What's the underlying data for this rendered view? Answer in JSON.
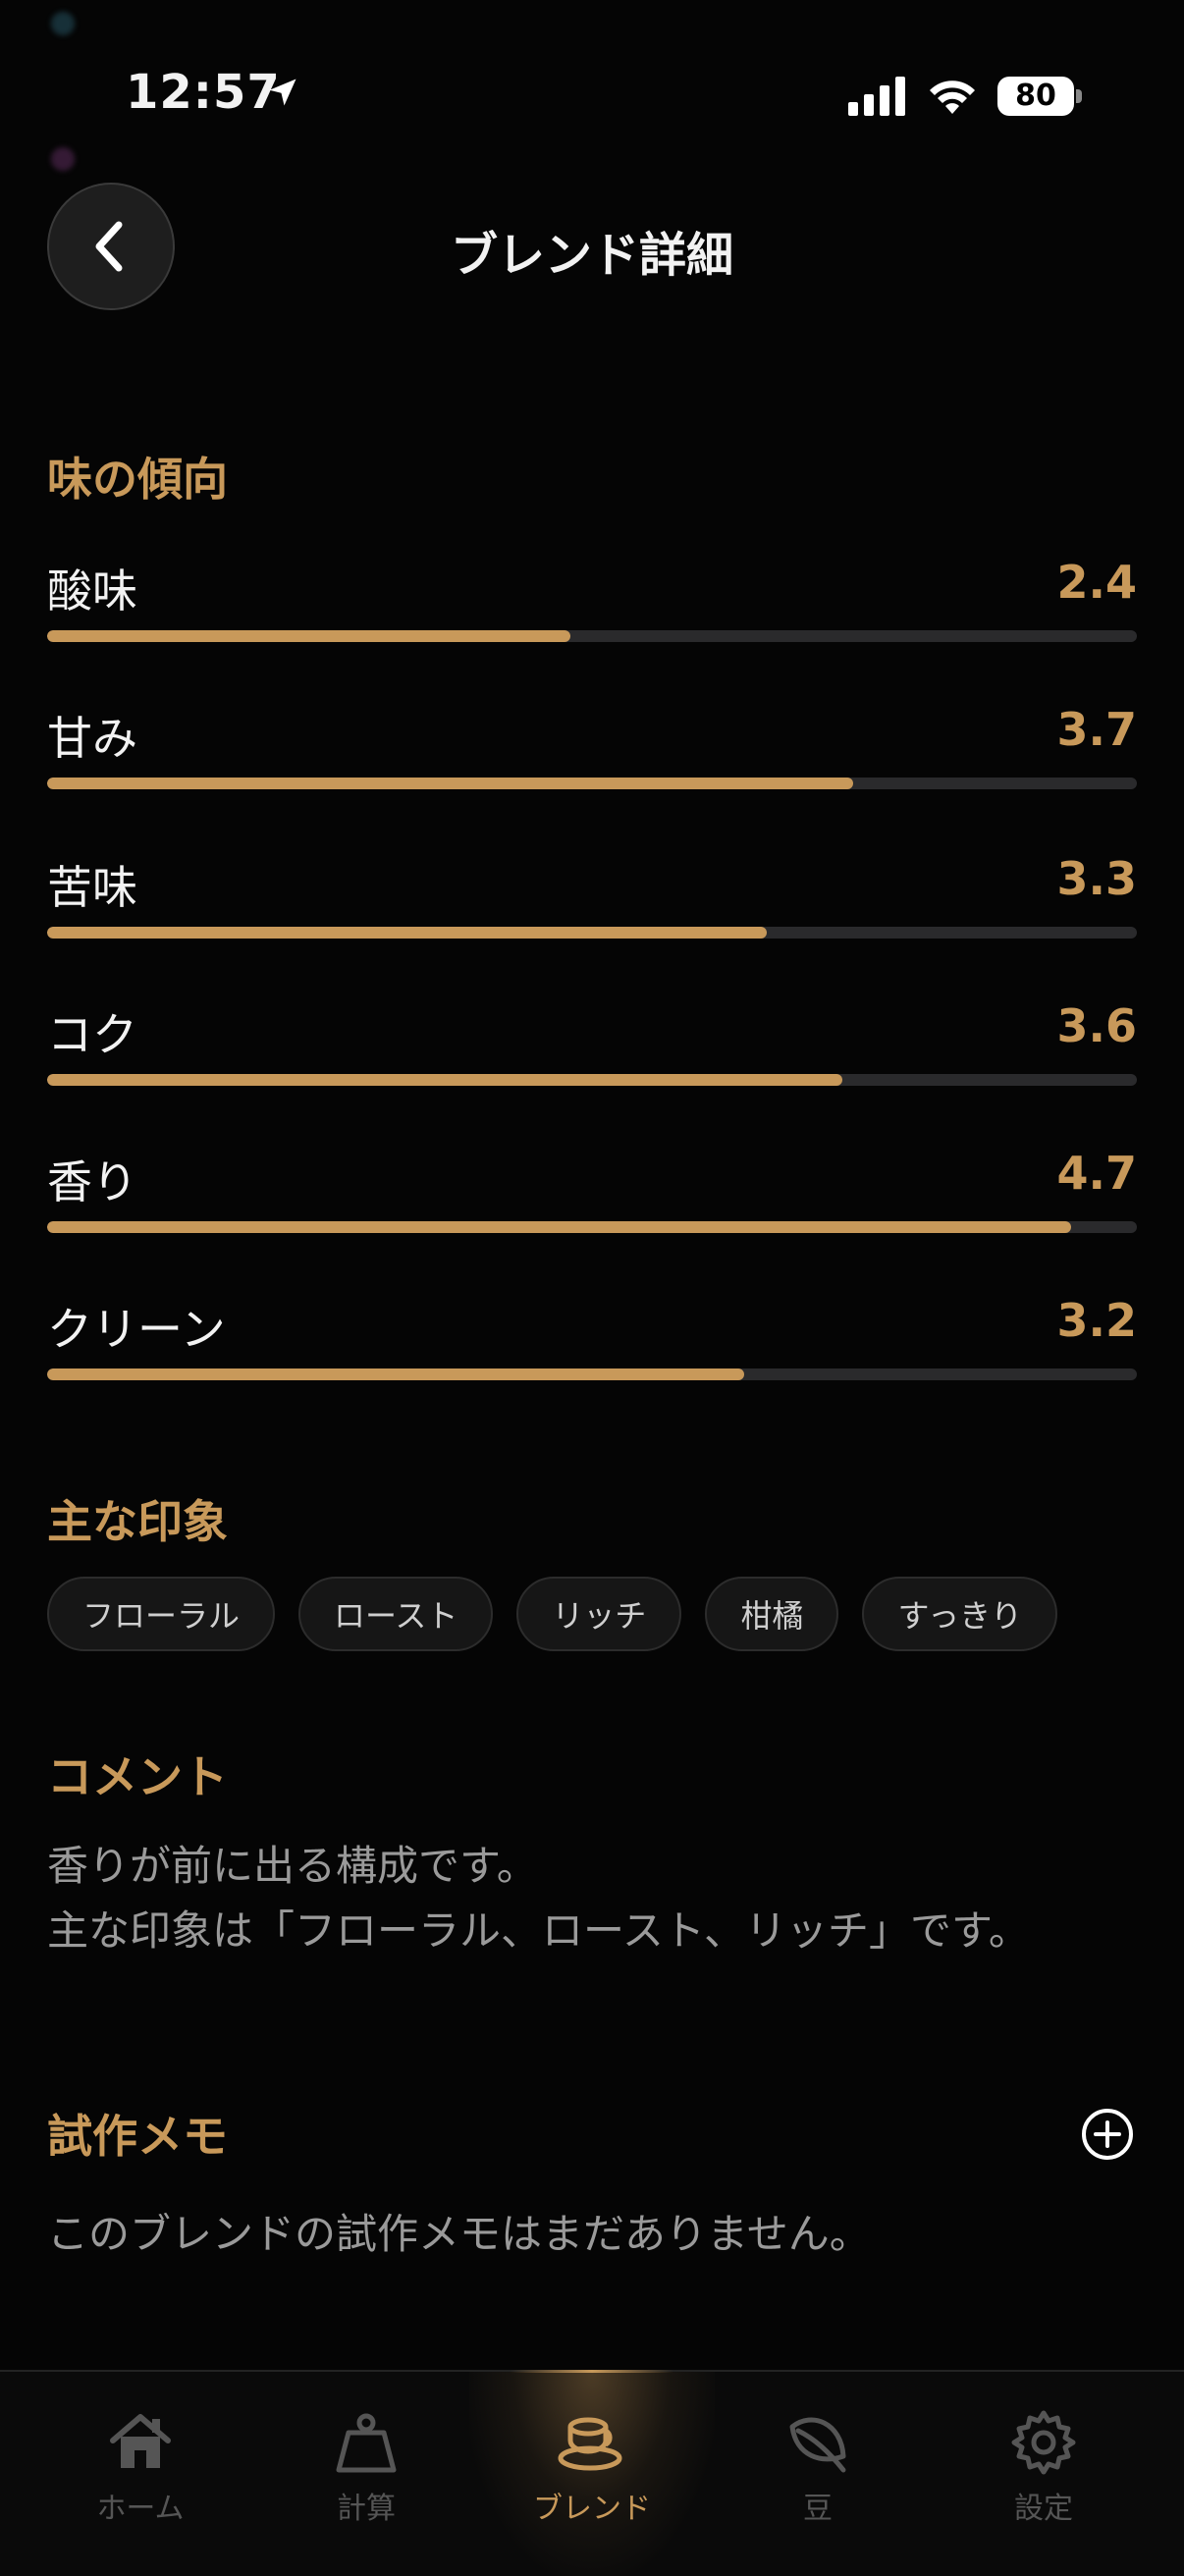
{
  "status_bar": {
    "time": "12:57",
    "battery": "80"
  },
  "header": {
    "title": "ブレンド詳細"
  },
  "taste": {
    "title": "味の傾向",
    "items": [
      {
        "label": "酸味",
        "value": "2.4",
        "fraction": 0.48
      },
      {
        "label": "甘み",
        "value": "3.7",
        "fraction": 0.74
      },
      {
        "label": "苦味",
        "value": "3.3",
        "fraction": 0.66
      },
      {
        "label": "コク",
        "value": "3.6",
        "fraction": 0.73
      },
      {
        "label": "香り",
        "value": "4.7",
        "fraction": 0.94
      },
      {
        "label": "クリーン",
        "value": "3.2",
        "fraction": 0.64
      }
    ]
  },
  "impressions": {
    "title": "主な印象",
    "tags": [
      "フローラル",
      "ロースト",
      "リッチ",
      "柑橘",
      "すっきり"
    ]
  },
  "comment": {
    "title": "コメント",
    "line1": "香りが前に出る構成です。",
    "line2": "主な印象は「フローラル、ロースト、リッチ」です。"
  },
  "memo": {
    "title": "試作メモ",
    "empty_text": "このブレンドの試作メモはまだありません。"
  },
  "tabs": [
    {
      "label": "ホーム",
      "icon": "home-icon"
    },
    {
      "label": "計算",
      "icon": "scale-icon"
    },
    {
      "label": "ブレンド",
      "icon": "cup-icon",
      "active": true
    },
    {
      "label": "豆",
      "icon": "leaf-icon"
    },
    {
      "label": "設定",
      "icon": "gear-icon"
    }
  ],
  "colors": {
    "accent": "#c8995a",
    "background": "#050505",
    "track": "#2a2a2c"
  }
}
